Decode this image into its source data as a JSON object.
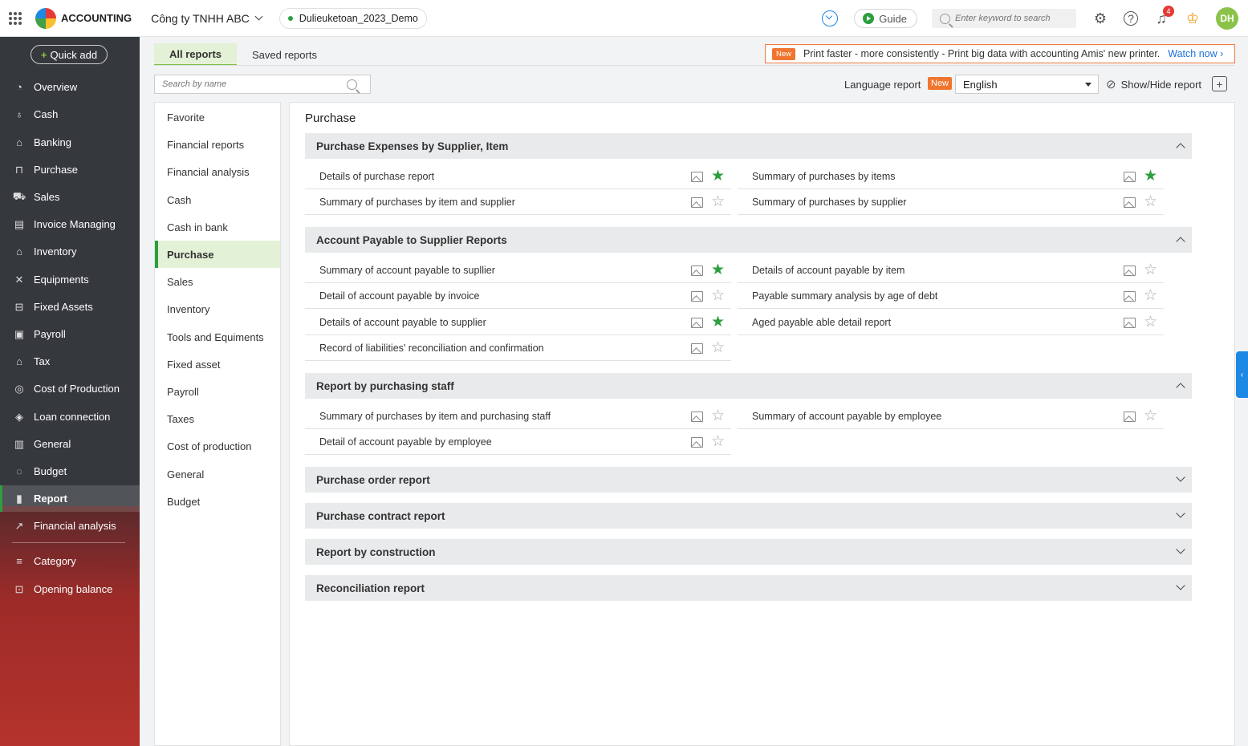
{
  "topbar": {
    "app_name": "ACCOUNTING",
    "company": "Công ty TNHH ABC",
    "database": "Dulieuketoan_2023_Demo",
    "guide_label": "Guide",
    "search_placeholder": "Enter keyword to search",
    "notification_count": "4",
    "avatar_initials": "DH"
  },
  "sidebar": {
    "quick_add": "Quick add",
    "items": [
      {
        "label": "Overview",
        "icon": "◔"
      },
      {
        "label": "Cash",
        "icon": "♁"
      },
      {
        "label": "Banking",
        "icon": "⌂"
      },
      {
        "label": "Purchase",
        "icon": "⊓"
      },
      {
        "label": "Sales",
        "icon": "⛟"
      },
      {
        "label": "Invoice Managing",
        "icon": "▤"
      },
      {
        "label": "Inventory",
        "icon": "⌂"
      },
      {
        "label": "Equipments",
        "icon": "✕"
      },
      {
        "label": "Fixed Assets",
        "icon": "⊟"
      },
      {
        "label": "Payroll",
        "icon": "▣"
      },
      {
        "label": "Tax",
        "icon": "⌂"
      },
      {
        "label": "Cost of Production",
        "icon": "◎"
      },
      {
        "label": "Loan connection",
        "icon": "◈"
      },
      {
        "label": "General",
        "icon": "▥"
      },
      {
        "label": "Budget",
        "icon": "◌"
      },
      {
        "label": "Report",
        "icon": "▮"
      },
      {
        "label": "Financial analysis",
        "icon": "↗"
      },
      {
        "label": "Category",
        "icon": "≡"
      },
      {
        "label": "Opening balance",
        "icon": "⊡"
      }
    ]
  },
  "tabs": {
    "all_reports": "All reports",
    "saved_reports": "Saved reports"
  },
  "promo": {
    "tag": "New",
    "text": "Print faster - more consistently - Print big data with accounting Amis' new printer.",
    "link": "Watch now"
  },
  "filters": {
    "search_placeholder": "Search by name",
    "language_label": "Language report",
    "language_new": "New",
    "language_value": "English",
    "show_hide": "Show/Hide report"
  },
  "categories": [
    "Favorite",
    "Financial reports",
    "Financial analysis",
    "Cash",
    "Cash in bank",
    "Purchase",
    "Sales",
    "Inventory",
    "Tools and Equiments",
    "Fixed asset",
    "Payroll",
    "Taxes",
    "Cost of production",
    "General",
    "Budget"
  ],
  "content": {
    "title": "Purchase",
    "sections": [
      {
        "title": "Purchase Expenses by Supplier, Item",
        "expanded": true,
        "reports": [
          {
            "name": "Details of purchase report",
            "favorite": true
          },
          {
            "name": "Summary of purchases by items",
            "favorite": true
          },
          {
            "name": "Summary of purchases by item and supplier",
            "favorite": false
          },
          {
            "name": "Summary of purchases by supplier",
            "favorite": false
          }
        ]
      },
      {
        "title": "Account Payable to Supplier Reports",
        "expanded": true,
        "reports": [
          {
            "name": "Summary of account payable to supllier",
            "favorite": true
          },
          {
            "name": "Details of account payable by item",
            "favorite": false
          },
          {
            "name": "Detail of account payable by invoice",
            "favorite": false
          },
          {
            "name": "Payable summary analysis by age of debt",
            "favorite": false
          },
          {
            "name": "Details of account payable to supplier",
            "favorite": true
          },
          {
            "name": "Aged payable able detail report",
            "favorite": false
          },
          {
            "name": "Record of liabilities' reconciliation and confirmation",
            "favorite": false
          }
        ]
      },
      {
        "title": "Report by purchasing staff",
        "expanded": true,
        "reports": [
          {
            "name": "Summary of purchases by item and purchasing staff",
            "favorite": false
          },
          {
            "name": "Summary of account payable by employee",
            "favorite": false
          },
          {
            "name": "Detail of account payable by employee",
            "favorite": false
          }
        ]
      },
      {
        "title": "Purchase order report",
        "expanded": false,
        "reports": []
      },
      {
        "title": "Purchase contract report",
        "expanded": false,
        "reports": []
      },
      {
        "title": "Report by construction",
        "expanded": false,
        "reports": []
      },
      {
        "title": "Reconciliation report",
        "expanded": false,
        "reports": []
      }
    ]
  },
  "colors": {
    "sidebar_bg": "#35383d",
    "accent_green": "#2e9e3e",
    "active_tab_bg": "#e3f1d7",
    "promo_orange": "#f0752e",
    "link_blue": "#1e6fd9"
  }
}
